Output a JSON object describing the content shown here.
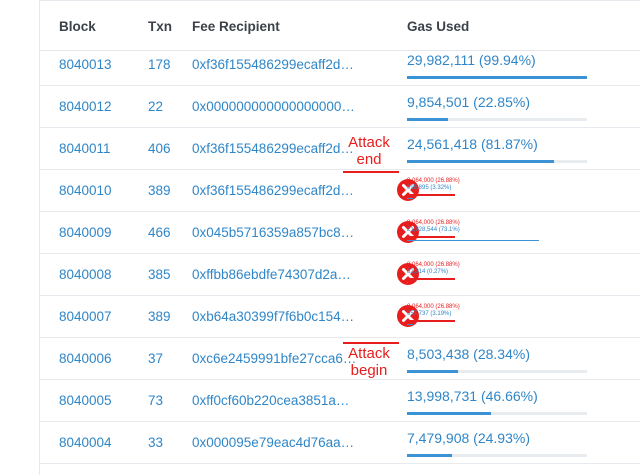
{
  "headers": {
    "block": "Block",
    "txn": "Txn",
    "fee": "Fee Recipient",
    "gas": "Gas Used"
  },
  "rows": [
    {
      "block": "8040013",
      "txn": "178",
      "fee": "0xf36f155486299ecaff2d…",
      "gas": "29,982,111 (99.94%)",
      "pct": 99.94
    },
    {
      "block": "8040012",
      "txn": "22",
      "fee": "0x000000000000000000…",
      "gas": "9,854,501 (22.85%)",
      "pct": 22.85
    },
    {
      "block": "8040011",
      "txn": "406",
      "fee": "0xf36f155486299ecaff2d…",
      "gas": "24,561,418 (81.87%)",
      "pct": 81.87
    },
    {
      "block": "8040010",
      "txn": "389",
      "fee": "0xf36f155486299ecaff2d…",
      "gas_a": "8,064,000 (26.88%)",
      "gas_b": "995,895 (3.32%)",
      "pct": 3.32
    },
    {
      "block": "8040009",
      "txn": "466",
      "fee": "0x045b5716359a857bc8…",
      "gas_a": "8,064,000 (26.88%)",
      "gas_b": "21,928,544 (73.1%)",
      "pct": 73.1
    },
    {
      "block": "8040008",
      "txn": "385",
      "fee": "0xffbb86ebdfe74307d2a…",
      "gas_a": "8,064,000 (26.88%)",
      "gas_b": "82,014 (0.27%)",
      "pct": 0.27
    },
    {
      "block": "8040007",
      "txn": "389",
      "fee": "0xb64a30399f7f6b0c154…",
      "gas_a": "8,064,000 (26.88%)",
      "gas_b": "957,737 (3.19%)",
      "pct": 3.19
    },
    {
      "block": "8040006",
      "txn": "37",
      "fee": "0xc6e2459991bfe27cca6…",
      "gas": "8,503,438 (28.34%)",
      "pct": 28.34
    },
    {
      "block": "8040005",
      "txn": "73",
      "fee": "0xff0cf60b220cea3851a…",
      "gas": "13,998,731 (46.66%)",
      "pct": 46.66
    },
    {
      "block": "8040004",
      "txn": "33",
      "fee": "0x000095e79eac4d76aa…",
      "gas": "7,479,908 (24.93%)",
      "pct": 24.93
    }
  ],
  "annotations": {
    "end": [
      "Attack",
      "end"
    ],
    "begin": [
      "Attack",
      "begin"
    ]
  },
  "colors": {
    "accent": "#2f86c8",
    "attack": "#e81d1d"
  },
  "icons": {
    "attacked": "x-circle-icon"
  }
}
